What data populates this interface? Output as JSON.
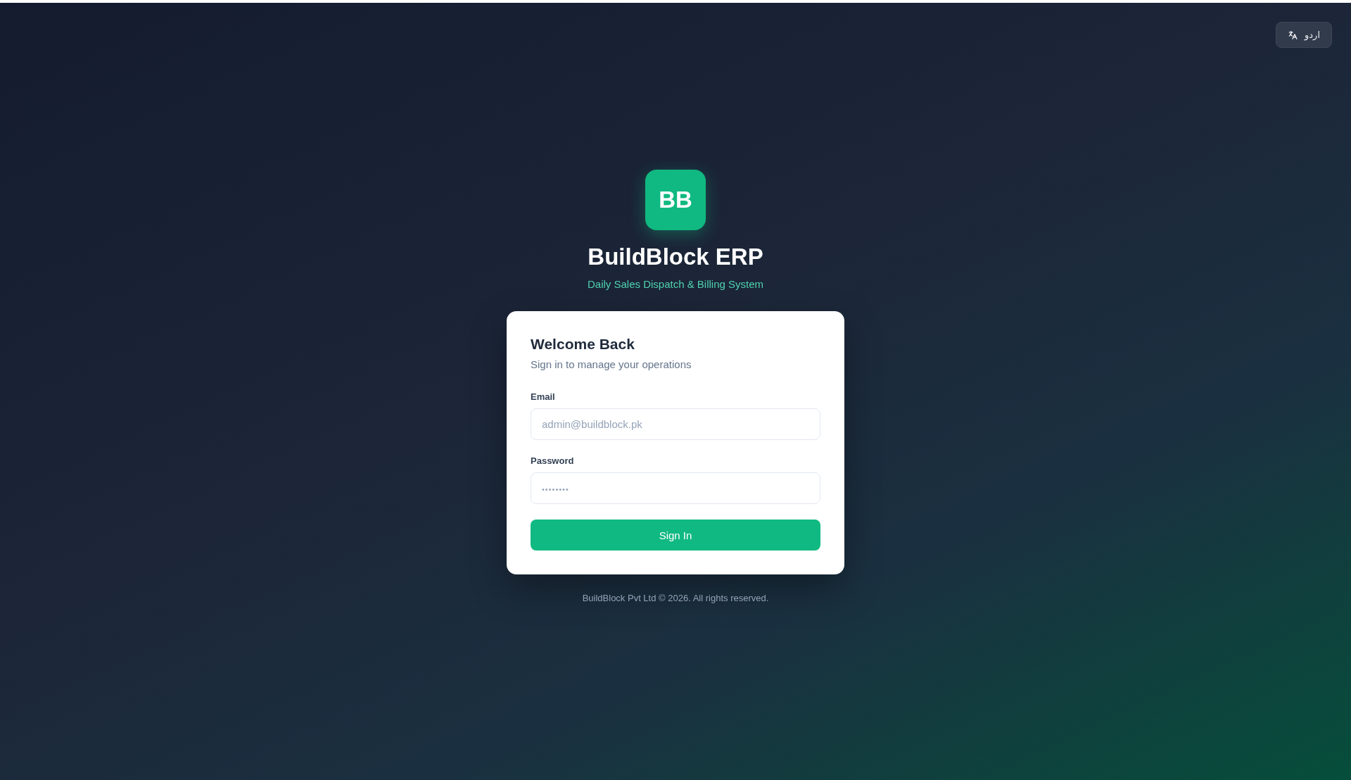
{
  "language_button": {
    "label": "اردو"
  },
  "brand": {
    "logo": "BB",
    "title": "BuildBlock ERP",
    "subtitle": "Daily Sales Dispatch & Billing System"
  },
  "login_card": {
    "heading": "Welcome Back",
    "subheading": "Sign in to manage your operations",
    "fields": [
      {
        "label": "Email",
        "kind": "email",
        "placeholder": "admin@buildblock.pk"
      },
      {
        "label": "Password",
        "kind": "password",
        "placeholder": "••••••••"
      }
    ],
    "submit": "Sign In"
  },
  "footer": "BuildBlock Pvt Ltd © 2026. All rights reserved."
}
